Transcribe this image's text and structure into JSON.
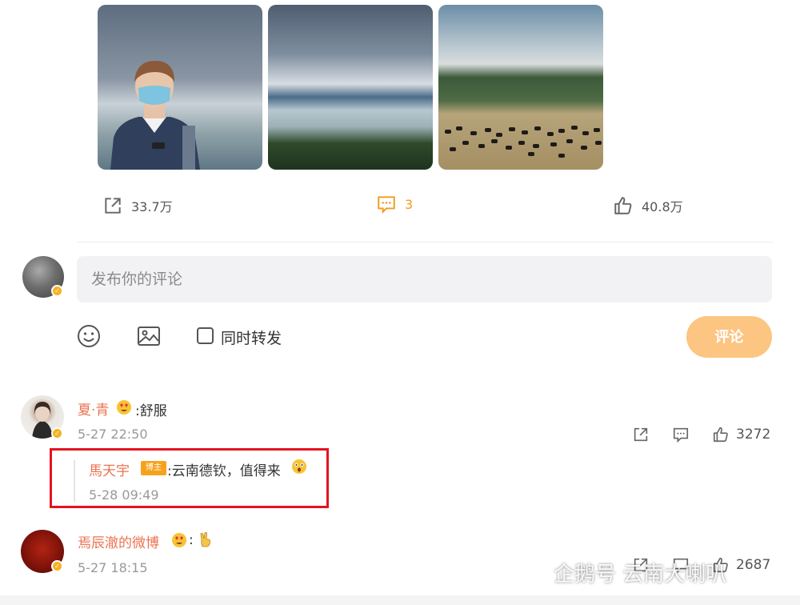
{
  "post": {
    "photos": [
      {
        "name": "photo-person"
      },
      {
        "name": "photo-lake"
      },
      {
        "name": "photo-grassland"
      }
    ],
    "actions": {
      "share_count": "33.7万",
      "comment_count": "3",
      "like_count": "40.8万"
    }
  },
  "comment_box": {
    "placeholder": "发布你的评论",
    "repost_label": "同时转发",
    "submit_label": "评论"
  },
  "comments": [
    {
      "user": "夏·青",
      "text": ":舒服",
      "time": "5-27 22:50",
      "likes": "3272",
      "reply": {
        "user": "馬天宇",
        "tag": "博主",
        "text": ":云南德钦，值得来",
        "time": "5-28 09:49"
      }
    },
    {
      "user": "焉辰澈的微博",
      "text": ":",
      "time": "5-27 18:15",
      "likes": "2687"
    }
  ],
  "watermark": {
    "text": "企鹅号 云南大喇叭"
  },
  "colors": {
    "accent_orange": "#f39a1e",
    "username": "#eb7350",
    "submit_button": "#fcc582",
    "highlight_box": "#e3141f"
  }
}
